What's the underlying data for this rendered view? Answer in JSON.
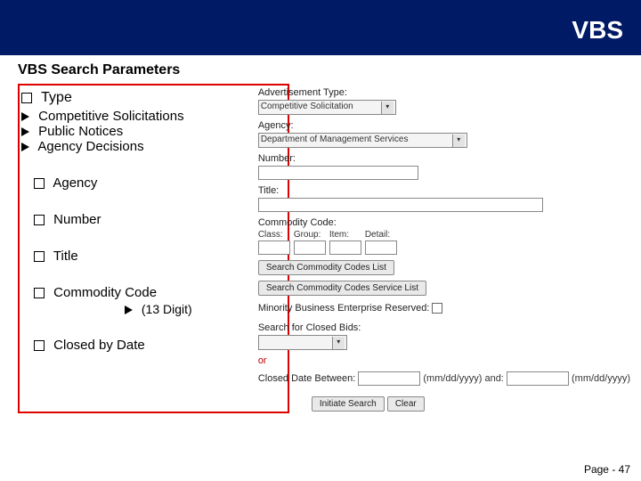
{
  "header": {
    "title": "VBS"
  },
  "subheader": {
    "title": "VBS Search Parameters"
  },
  "left": {
    "type_label": "Type",
    "type_items": {
      "a": "Competitive Solicitations",
      "b": "Public Notices",
      "c": "Agency Decisions"
    },
    "agency_label": "Agency",
    "number_label": "Number",
    "title_label": "Title",
    "commodity_label": "Commodity Code",
    "digit_label": "(13 Digit)",
    "closed_label": "Closed by Date"
  },
  "form": {
    "adv_type_label": "Advertisement Type:",
    "adv_type_value": "Competitive Solicitation",
    "agency_label": "Agency:",
    "agency_value": "Department of Management Services",
    "number_label": "Number:",
    "title_label": "Title:",
    "cc_label": "Commodity Code:",
    "cc_class": "Class:",
    "cc_group": "Group:",
    "cc_item": "Item:",
    "cc_detail": "Detail:",
    "cc_search_btn": "Search Commodity Codes List",
    "cc_service_btn": "Search Commodity Codes Service List",
    "mbe_label": "Minority Business Enterprise Reserved:",
    "closed_label": "Search for Closed Bids:",
    "or_label": "or",
    "closed_between_label": "Closed Date Between:",
    "date_fmt": "(mm/dd/yyyy)",
    "and_label": "and:",
    "initiate_btn": "Initiate Search",
    "clear_btn": "Clear"
  },
  "footer": {
    "page_label": "Page - 47"
  }
}
